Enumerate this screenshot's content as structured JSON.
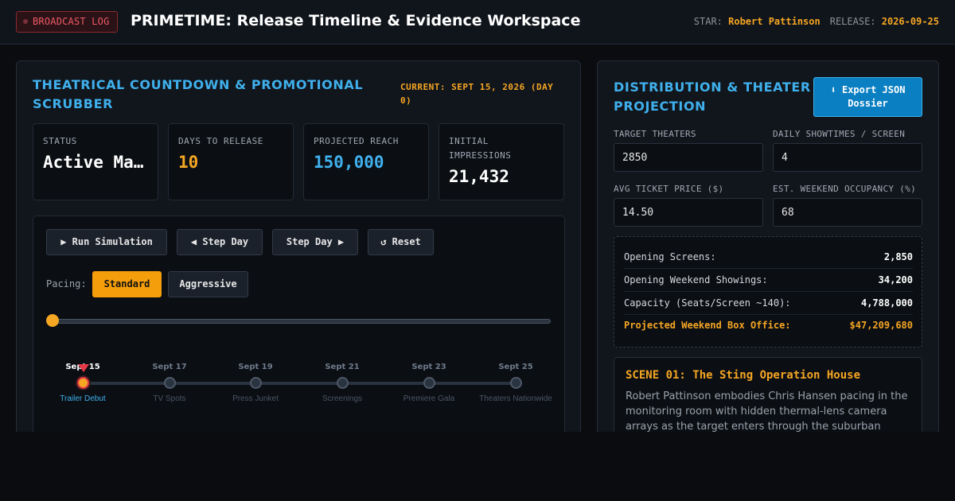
{
  "header": {
    "badge": "BROADCAST LOG",
    "title": "PRIMETIME: Release Timeline & Evidence Workspace",
    "star_label": "STAR:",
    "star_value": "Robert Pattinson",
    "release_label": "RELEASE:",
    "release_value": "2026-09-25"
  },
  "countdown": {
    "title": "THEATRICAL COUNTDOWN & PROMOTIONAL SCRUBBER",
    "current": "CURRENT: SEPT 15, 2026 (DAY 0)",
    "stats": [
      {
        "label": "STATUS",
        "value": "Active Manhunt",
        "color": "#ffffff"
      },
      {
        "label": "DAYS TO RELEASE",
        "value": "10",
        "color": "#f5a623"
      },
      {
        "label": "PROJECTED REACH",
        "value": "150,000",
        "color": "#3fb0ec"
      },
      {
        "label": "INITIAL IMPRESSIONS",
        "value": "21,432",
        "color": "#ffffff"
      }
    ]
  },
  "controls": {
    "run": "▶ Run Simulation",
    "step_back": "◀ Step Day",
    "step_forward": "Step Day ▶",
    "reset": "↺ Reset",
    "pacing_label": "Pacing:",
    "pacing_standard": "Standard",
    "pacing_aggressive": "Aggressive",
    "pacing_selected": "Standard",
    "scrubber_progress": 0
  },
  "timeline": [
    {
      "date": "Sept 15",
      "label": "Trailer Debut",
      "active": true
    },
    {
      "date": "Sept 17",
      "label": "TV Spots",
      "active": false
    },
    {
      "date": "Sept 19",
      "label": "Press Junket",
      "active": false
    },
    {
      "date": "Sept 21",
      "label": "Screenings",
      "active": false
    },
    {
      "date": "Sept 23",
      "label": "Premiere Gala",
      "active": false
    },
    {
      "date": "Sept 25",
      "label": "Theaters Nationwide",
      "active": false
    }
  ],
  "distribution": {
    "title": "DISTRIBUTION & THEATER PROJECTION",
    "export_label": "⬇ Export JSON Dossier",
    "fields": {
      "target_theaters": {
        "label": "TARGET THEATERS",
        "value": "2850"
      },
      "daily_showtimes": {
        "label": "DAILY SHOWTIMES / SCREEN",
        "value": "4"
      },
      "ticket_price": {
        "label": "AVG TICKET PRICE ($)",
        "value": "14.50"
      },
      "occupancy": {
        "label": "EST. WEEKEND OCCUPANCY (%)",
        "value": "68"
      }
    },
    "summary": [
      {
        "key": "Opening Screens:",
        "value": "2,850"
      },
      {
        "key": "Opening Weekend Showings:",
        "value": "34,200"
      },
      {
        "key": "Capacity (Seats/Screen ~140):",
        "value": "4,788,000"
      },
      {
        "key": "Projected Weekend Box Office:",
        "value": "$47,209,680"
      }
    ]
  },
  "scene": {
    "title": "SCENE 01: The Sting Operation House",
    "body": "Robert Pattinson embodies Chris Hansen pacing in the monitoring room with hidden thermal-lens camera arrays as the target enters through the suburban"
  },
  "colors": {
    "accent": "#3fb0ec",
    "highlight": "#f5a623",
    "alert": "#e63946",
    "background": "#0a0c10"
  }
}
